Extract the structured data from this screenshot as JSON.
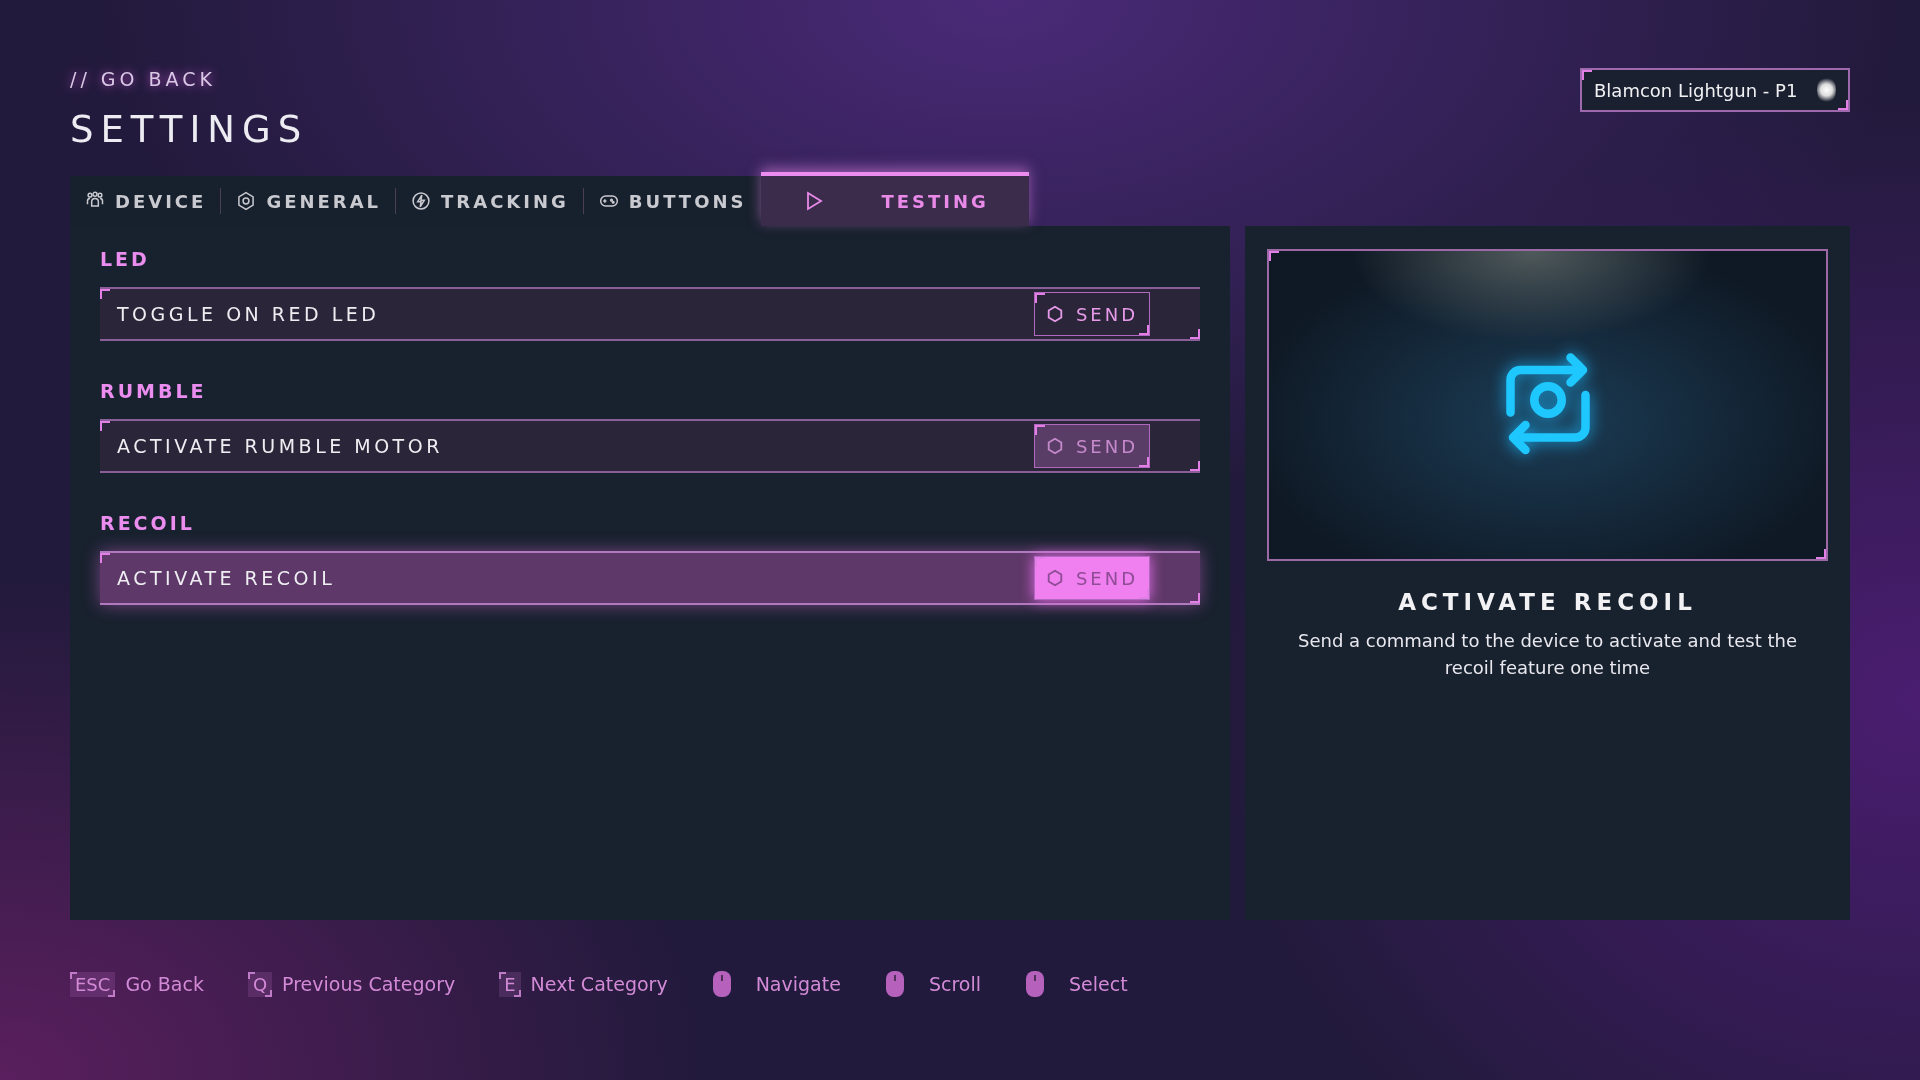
{
  "header": {
    "back_link": "// GO BACK",
    "title": "SETTINGS",
    "device": "Blamcon Lightgun - P1"
  },
  "tabs": [
    {
      "label": "DEVICE",
      "selected": false
    },
    {
      "label": "GENERAL",
      "selected": false
    },
    {
      "label": "TRACKING",
      "selected": false
    },
    {
      "label": "BUTTONS",
      "selected": false
    },
    {
      "label": "TESTING",
      "selected": true
    }
  ],
  "sections": [
    {
      "heading": "LED",
      "action": {
        "label": "TOGGLE ON RED LED",
        "button": "SEND",
        "selected": false,
        "button_hovered": false,
        "button_dimmed": false
      }
    },
    {
      "heading": "RUMBLE",
      "action": {
        "label": "ACTIVATE RUMBLE MOTOR",
        "button": "SEND",
        "selected": false,
        "button_hovered": false,
        "button_dimmed": true
      }
    },
    {
      "heading": "RECOIL",
      "action": {
        "label": "ACTIVATE RECOIL",
        "button": "SEND",
        "selected": true,
        "button_hovered": true,
        "button_dimmed": false
      }
    }
  ],
  "preview": {
    "title": "ACTIVATE RECOIL",
    "description": "Send a command to the device to activate and test the recoil feature one time"
  },
  "hints": [
    {
      "kind": "key",
      "key": "ESC",
      "label": "Go Back"
    },
    {
      "kind": "key",
      "key": "Q",
      "label": "Previous Category"
    },
    {
      "kind": "key",
      "key": "E",
      "label": "Next Category"
    },
    {
      "kind": "mouse",
      "label": "Navigate"
    },
    {
      "kind": "mouse",
      "label": "Scroll"
    },
    {
      "kind": "mouse",
      "label": "Select"
    }
  ]
}
